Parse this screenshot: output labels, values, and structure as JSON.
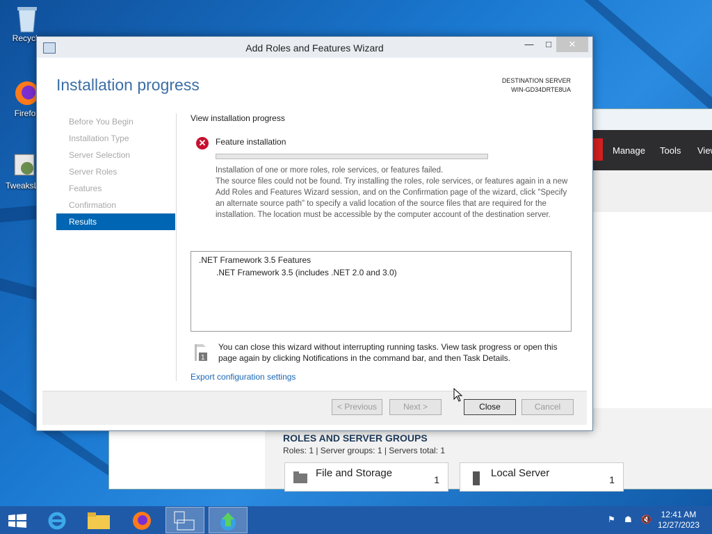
{
  "desktop": {
    "icons": [
      {
        "label": "Recycle",
        "icon": "recycle-bin-icon"
      },
      {
        "label": "Firefox",
        "icon": "firefox-icon"
      },
      {
        "label": "TweaksLo",
        "icon": "tweaks-icon"
      }
    ]
  },
  "server_manager": {
    "menu": [
      "Manage",
      "Tools",
      "View"
    ],
    "roles_title": "ROLES AND SERVER GROUPS",
    "roles_sub": "Roles: 1   |   Server groups: 1   |   Servers total: 1",
    "tiles": [
      {
        "title": "File and Storage",
        "count": "1"
      },
      {
        "title": "Local Server",
        "count": "1"
      }
    ]
  },
  "wizard": {
    "title": "Add Roles and Features Wizard",
    "heading": "Installation progress",
    "destination_label": "DESTINATION SERVER",
    "destination_server": "WIN-GD34DRTE8UA",
    "nav": [
      {
        "label": "Before You Begin",
        "active": false
      },
      {
        "label": "Installation Type",
        "active": false
      },
      {
        "label": "Server Selection",
        "active": false
      },
      {
        "label": "Server Roles",
        "active": false
      },
      {
        "label": "Features",
        "active": false
      },
      {
        "label": "Confirmation",
        "active": false
      },
      {
        "label": "Results",
        "active": true
      }
    ],
    "section_label": "View installation progress",
    "feature_label": "Feature installation",
    "progress": 0,
    "message_line1": "Installation of one or more roles, role services, or features failed.",
    "message_body": "The source files could not be found. Try installing the roles, role services, or features again in a new Add Roles and Features Wizard session, and on the Confirmation page of the wizard, click \"Specify an alternate source path\" to specify a valid location of the source files that are required for the installation. The location must be accessible by the computer account of the destination server.",
    "list": {
      "parent": ".NET Framework 3.5 Features",
      "child": ".NET Framework 3.5 (includes .NET 2.0 and 3.0)"
    },
    "note": "You can close this wizard without interrupting running tasks. View task progress or open this page again by clicking Notifications in the command bar, and then Task Details.",
    "note_badge": "1",
    "export_link": "Export configuration settings",
    "buttons": {
      "previous": "< Previous",
      "next": "Next >",
      "close": "Close",
      "cancel": "Cancel"
    }
  },
  "taskbar": {
    "time": "12:41 AM",
    "date": "12/27/2023"
  }
}
